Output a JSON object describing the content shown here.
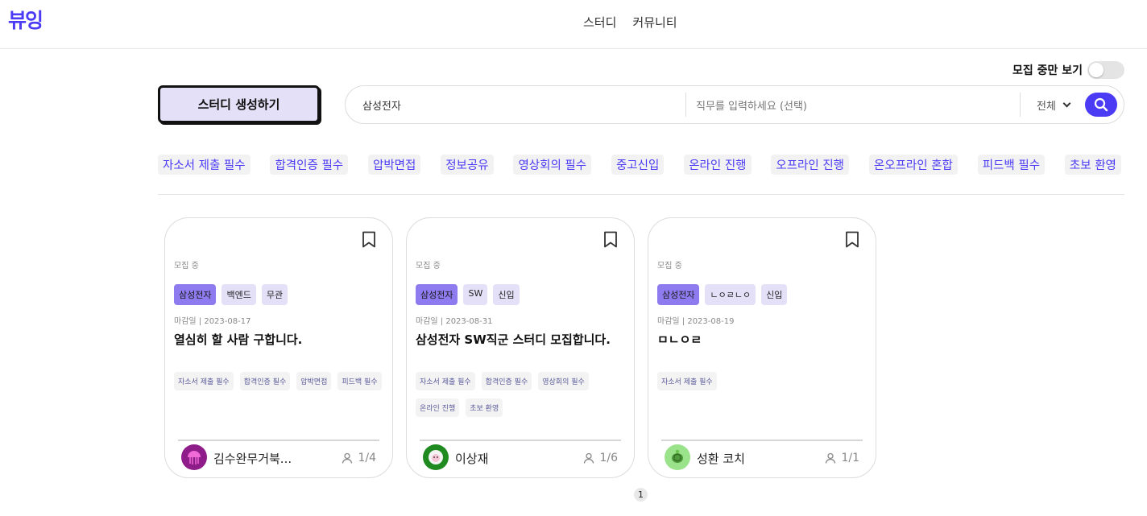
{
  "header": {
    "logo": "뷰잉",
    "nav": [
      "스터디",
      "커뮤니티"
    ]
  },
  "toggle": {
    "label": "모집 중만 보기",
    "on": false
  },
  "create_button": "스터디 생성하기",
  "search": {
    "company_value": "삼성전자",
    "job_placeholder": "직무를 입력하세요 (선택)",
    "select_value": "전체"
  },
  "filters": [
    "자소서 제출 필수",
    "합격인증 필수",
    "압박면접",
    "정보공유",
    "영상회의 필수",
    "중고신입",
    "온라인 진행",
    "오프라인 진행",
    "온오프라인 혼합",
    "피드백 필수",
    "초보 환영"
  ],
  "cards": [
    {
      "status": "모집 중",
      "tags": [
        "삼성전자",
        "백엔드",
        "무관"
      ],
      "deadline": "마감일 | 2023-08-17",
      "title": "열심히 할 사람 구합니다.",
      "chips": [
        "자소서 제출 필수",
        "합격인증 필수",
        "압박면접",
        "피드백 필수"
      ],
      "author": "김수완무거북...",
      "members": "1/4"
    },
    {
      "status": "모집 중",
      "tags": [
        "삼성전자",
        "SW",
        "신입"
      ],
      "deadline": "마감일 | 2023-08-31",
      "title": "삼성전자 SW직군 스터디 모집합니다.",
      "chips": [
        "자소서 제출 필수",
        "합격인증 필수",
        "영상회의 필수",
        "온라인 진행",
        "초보 환영"
      ],
      "author": "이상재",
      "members": "1/6"
    },
    {
      "status": "모집 중",
      "tags": [
        "삼성전자",
        "ㄴㅇㄹㄴㅇ",
        "신입"
      ],
      "deadline": "마감일 | 2023-08-19",
      "title": "ㅁㄴㅇㄹ",
      "chips": [
        "자소서 제출 필수"
      ],
      "author": "성환 코치",
      "members": "1/1"
    }
  ],
  "pagination": {
    "current": "1"
  },
  "colors": {
    "accent": "#4b3bf5",
    "tag_primary": "#8e7bf0",
    "tag_secondary": "#e4e0f8"
  }
}
